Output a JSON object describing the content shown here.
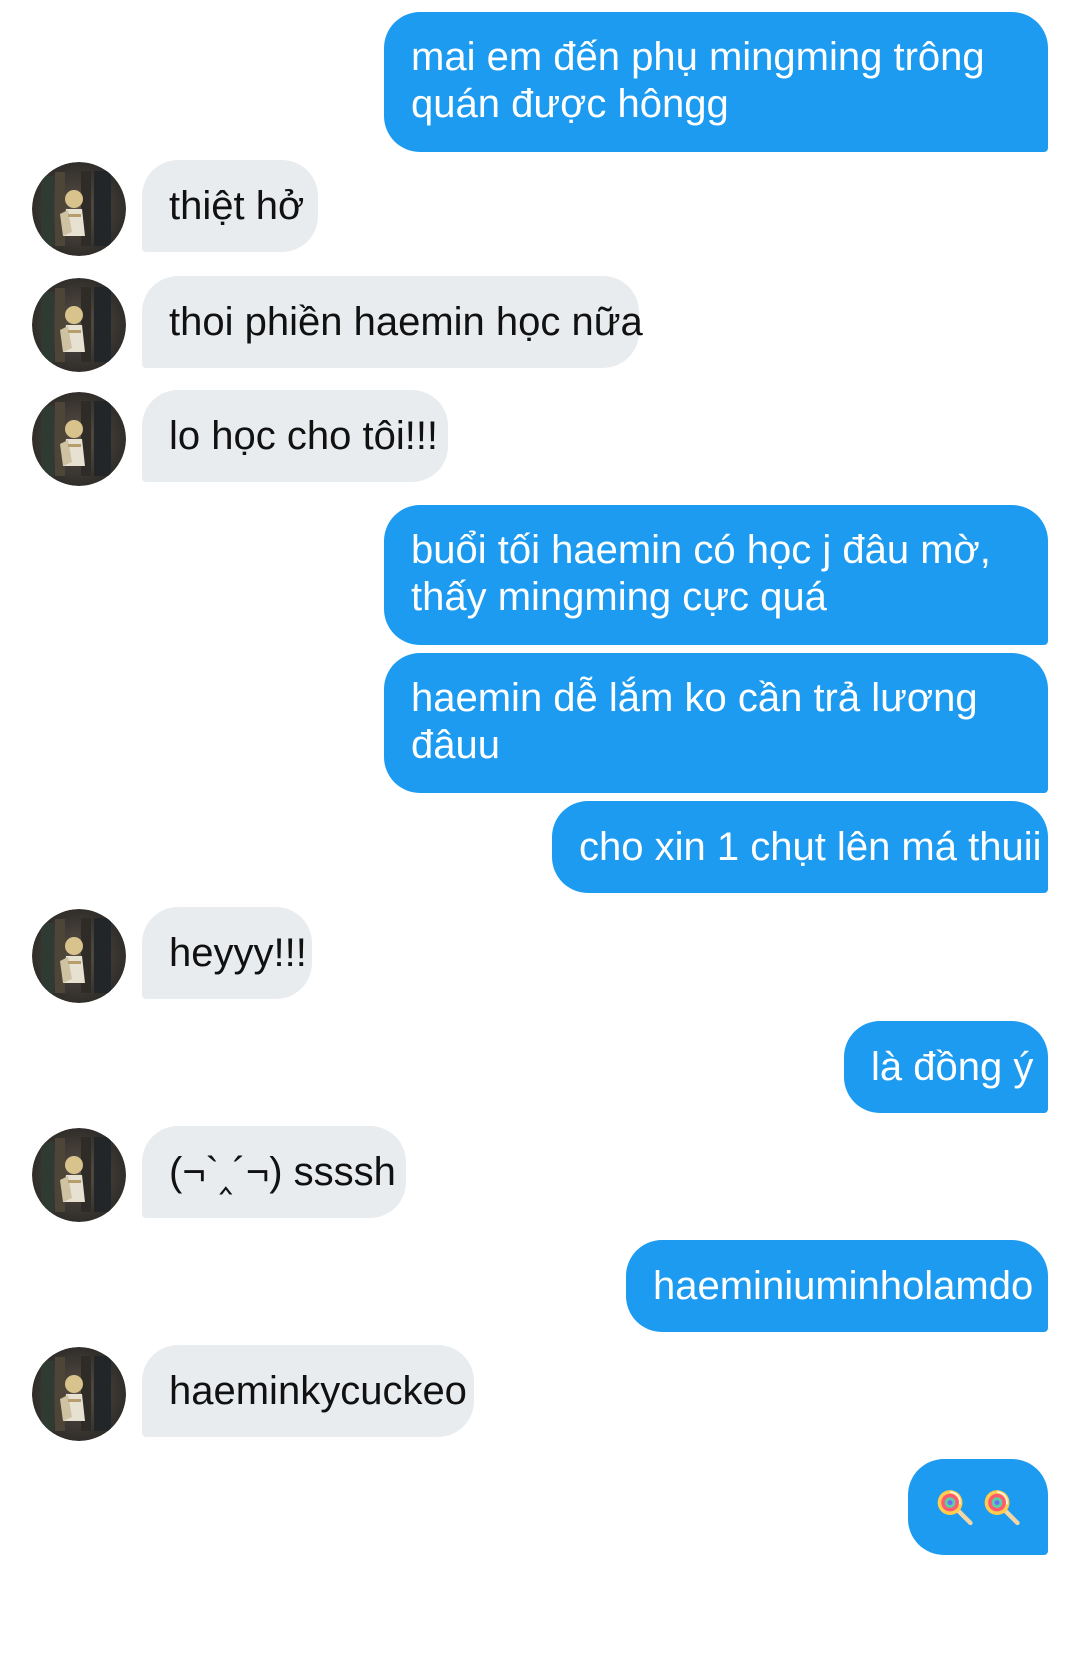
{
  "conversation": {
    "messages": [
      {
        "sender": "me",
        "text": "mai em đến phụ mingming trông\nquán được hôngg"
      },
      {
        "sender": "other",
        "text": "thiệt hở"
      },
      {
        "sender": "other",
        "text": "thoi phiền haemin học nữa"
      },
      {
        "sender": "other",
        "text": "lo học cho tôi!!!"
      },
      {
        "sender": "me",
        "text": "buổi tối haemin có học j đâu mờ,\nthấy mingming cực quá"
      },
      {
        "sender": "me",
        "text": "haemin dễ lắm ko cần trả lương\nđâuu"
      },
      {
        "sender": "me",
        "text": "cho xin 1 chụt lên má thuii"
      },
      {
        "sender": "other",
        "text": "heyyy!!!"
      },
      {
        "sender": "me",
        "text": "là đồng ý"
      },
      {
        "sender": "other",
        "text": "(¬`‸´¬) ssssh"
      },
      {
        "sender": "me",
        "text": "haeminiuminholamdo"
      },
      {
        "sender": "other",
        "text": "haeminkycuckeo"
      },
      {
        "sender": "me",
        "sticker": [
          "lollipop-icon",
          "lollipop-icon"
        ]
      }
    ]
  },
  "theme": {
    "outgoing_bubble": "#1d9bf0",
    "incoming_bubble": "#e9ecef",
    "outgoing_text": "#ffffff",
    "incoming_text": "#111111",
    "background": "#ffffff"
  }
}
